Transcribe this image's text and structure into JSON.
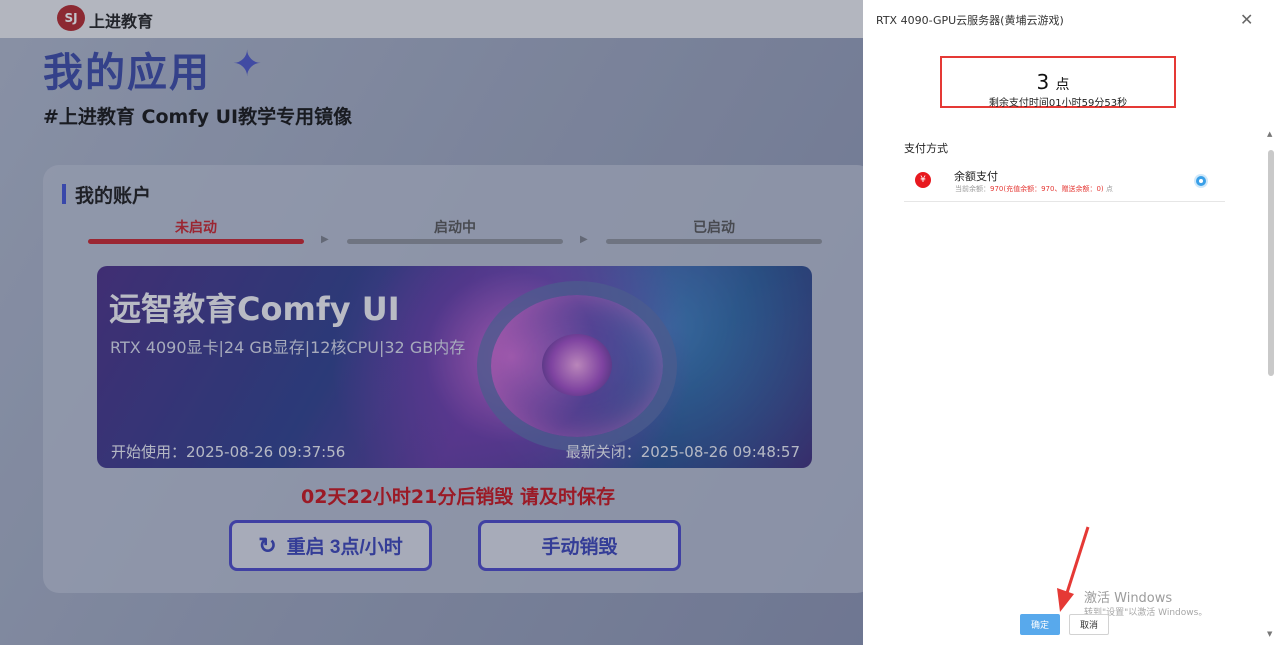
{
  "header": {
    "logo_text": "SJ",
    "brand": "上进教育"
  },
  "main": {
    "title": "我的应用",
    "subtitle": "#上进教育 Comfy UI教学专用镜像",
    "account": {
      "title": "我的账户",
      "steps": [
        {
          "label": "未启动",
          "color": "#c8232b"
        },
        {
          "label": "启动中",
          "color": "#555555"
        },
        {
          "label": "已启动",
          "color": "#555555"
        }
      ],
      "banner": {
        "title": "远智教育Comfy UI",
        "spec": "RTX 4090显卡|24 GB显存|12核CPU|32 GB内存",
        "start_time": "开始使用：2025-08-26 09:37:56",
        "close_time": "最新关闭：2025-08-26 09:48:57"
      },
      "destroy_notice": "02天22小时21分后销毁 请及时保存",
      "restart_button": "重启 3点/小时",
      "destroy_button": "手动销毁"
    }
  },
  "drawer": {
    "title": "RTX 4090-GPU云服务器(黄埔云游戏)",
    "price_value": "3",
    "price_unit": "点",
    "countdown": "剩余支付时间01小时59分53秒",
    "pay_section_title": "支付方式",
    "pay_method": {
      "icon": "¥",
      "name": "余额支付",
      "balance_prefix": "当前余额：",
      "balance_detail": "970(充值余额：970、赠送余额：0)",
      "balance_suffix": "点",
      "selected": true
    },
    "confirm_label": "确定",
    "cancel_label": "取消"
  },
  "watermark": {
    "line1": "激活 Windows",
    "line2": "转到\"设置\"以激活 Windows。"
  },
  "colors": {
    "accent_blue": "#4a47c8",
    "alert_red": "#c8121b",
    "confirm_blue": "#58a9ec",
    "highlight_box": "#e53935"
  }
}
